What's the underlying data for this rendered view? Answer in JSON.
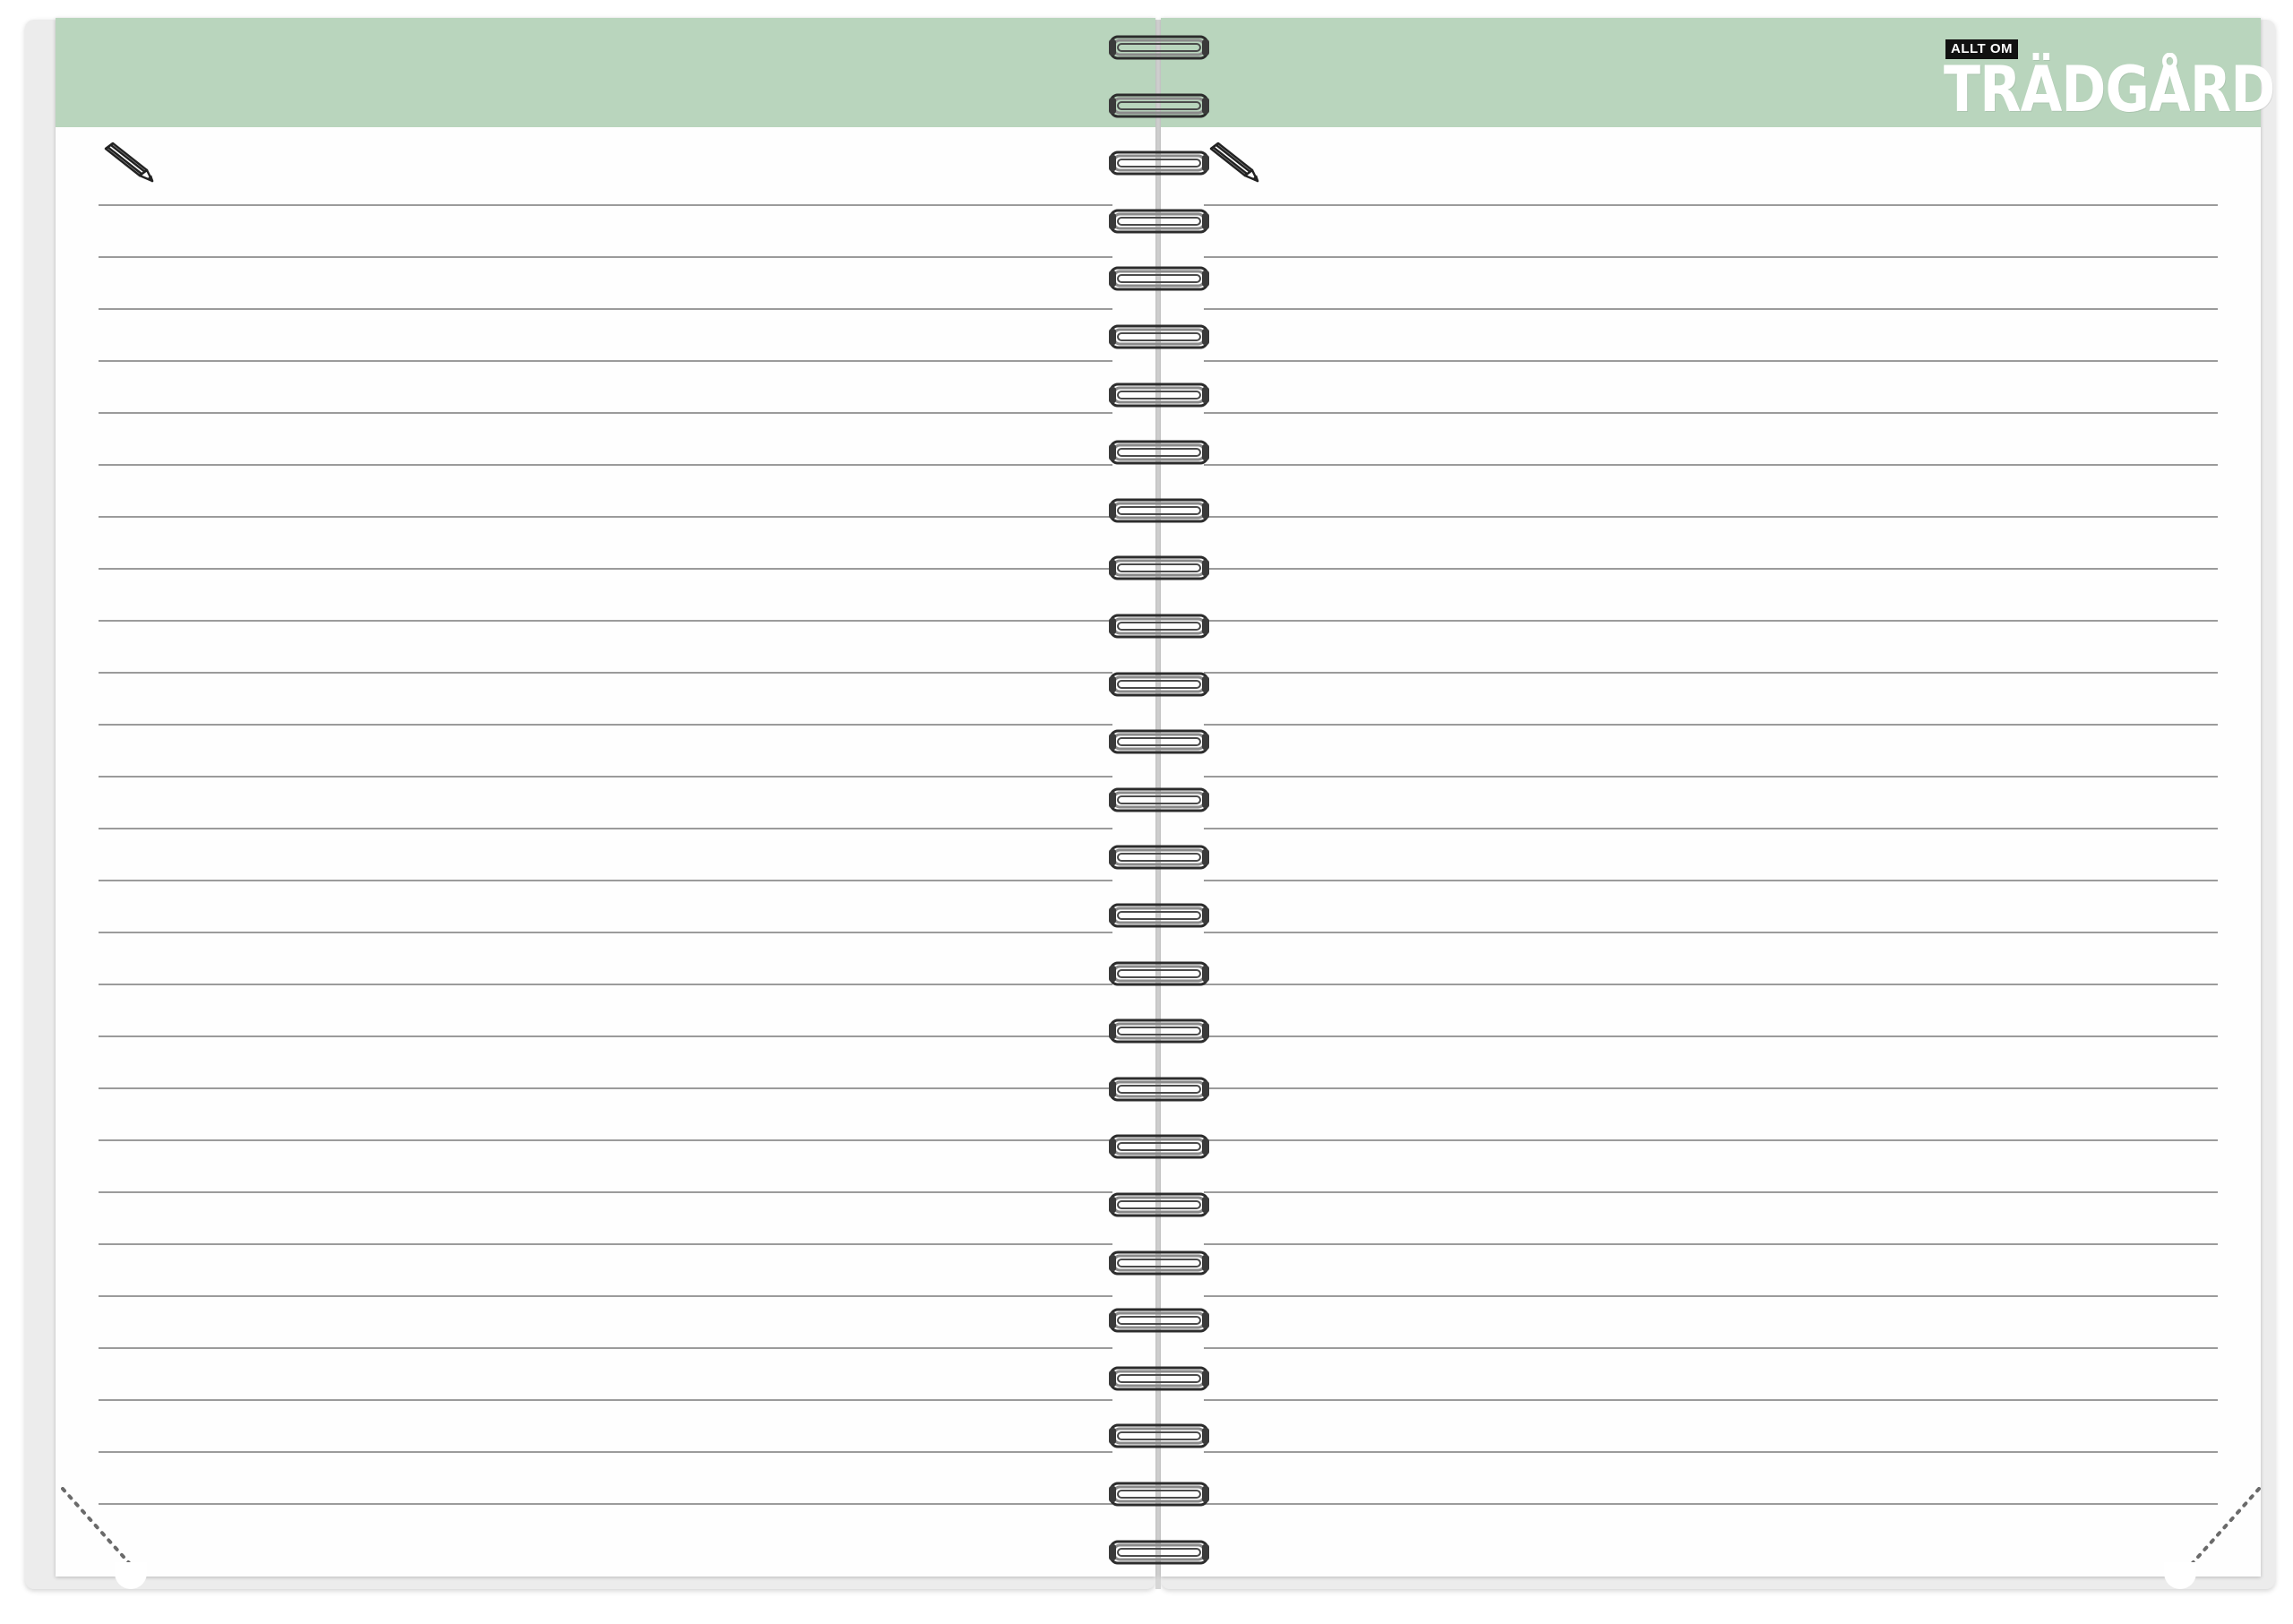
{
  "notebook": {
    "accent_color": "#b9d5bd",
    "rule_color": "#9b9b9b",
    "spiral_color": "#8a8a8a",
    "left_page": {
      "icon": "pencil-icon",
      "rule_count": 26
    },
    "right_page": {
      "icon": "pencil-icon",
      "rule_count": 26,
      "logo": {
        "small_text": "ALLT OM",
        "big_text": "TRÄDGÅRD"
      }
    },
    "spiral_ring_count": 27
  }
}
